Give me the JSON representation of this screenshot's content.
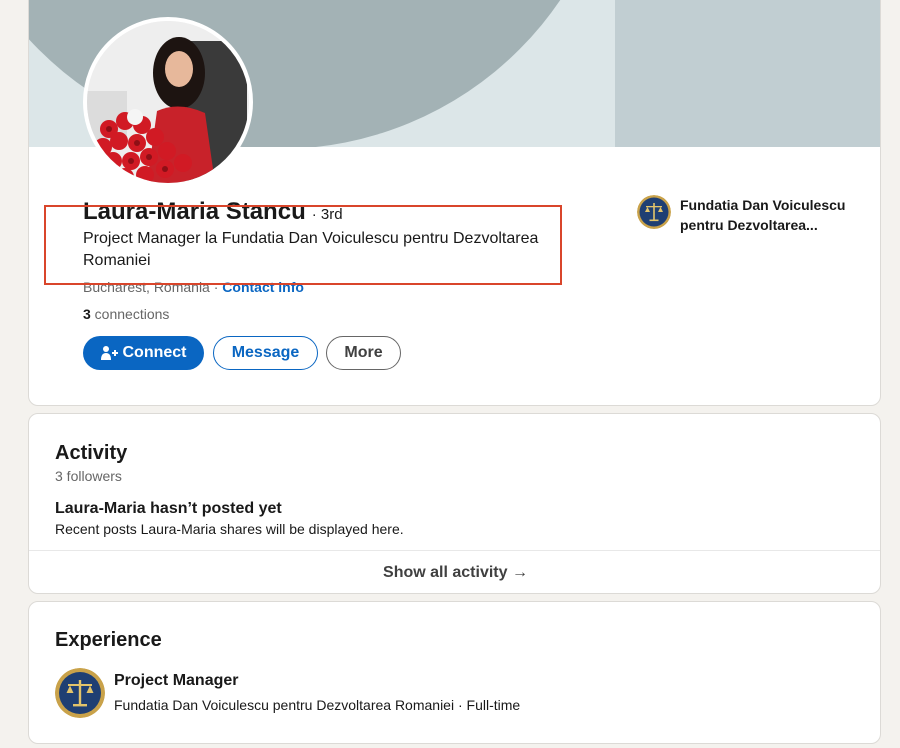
{
  "profile": {
    "name": "Laura-Maria Stancu",
    "degree": "· 3rd",
    "headline": "Project Manager la Fundatia Dan Voiculescu pentru Dezvoltarea Romaniei",
    "location": "Bucharest, Romania",
    "location_separator": " · ",
    "contact_info": "Contact info",
    "connections_count": "3",
    "connections_label": " connections"
  },
  "actions": {
    "connect_label": "Connect",
    "message_label": "Message",
    "more_label": "More"
  },
  "organization": {
    "name": "Fundatia Dan Voiculescu pentru Dezvoltarea..."
  },
  "activity": {
    "title": "Activity",
    "followers": "3 followers",
    "empty_title": "Laura-Maria hasn’t posted yet",
    "empty_sub": "Recent posts Laura-Maria shares will be displayed here.",
    "show_all": "Show all activity →"
  },
  "experience": {
    "title": "Experience",
    "items": [
      {
        "role": "Project Manager",
        "company_line": "Fundatia Dan Voiculescu pentru Dezvoltarea Romaniei · Full-time"
      }
    ]
  },
  "colors": {
    "accent": "#0a66c2",
    "highlight_border": "#d9452b",
    "page_bg": "#f4f2ee"
  },
  "icons": {
    "connect": "add-person-icon",
    "org_logo": "scales-of-justice-icon"
  }
}
